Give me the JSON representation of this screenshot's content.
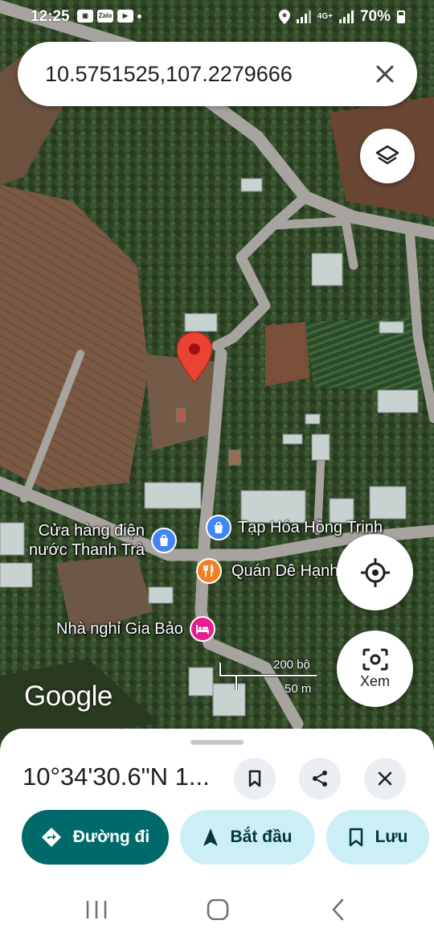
{
  "status_bar": {
    "time": "12:25",
    "battery": "70%",
    "network": "4G+",
    "app_icons": [
      "gallery-icon",
      "zalo-icon",
      "youtube-icon"
    ],
    "zalo_text": "Zalo"
  },
  "search": {
    "query": "10.5751525,107.2279666"
  },
  "map": {
    "pois": [
      {
        "name": "Cửa hàng điện\nnước Thanh Trà",
        "type": "shop",
        "icon": "shopping-bag-icon",
        "color": "#4285f4"
      },
      {
        "name": "Tạp Hóa Hồng Trinh",
        "type": "shop",
        "icon": "shopping-bag-icon",
        "color": "#4285f4"
      },
      {
        "name": "Quán Dê Hạnh",
        "type": "restaurant",
        "icon": "fork-knife-icon",
        "color": "#f07f26"
      },
      {
        "name": "Nhà nghỉ Gia Bảo",
        "type": "lodging",
        "icon": "bed-icon",
        "color": "#e91e8c"
      }
    ],
    "pin_color": "#ea4335",
    "scale": {
      "imperial": "200 bộ",
      "metric": "50 m"
    },
    "logo": "Google",
    "lens_label": "Xem"
  },
  "sheet": {
    "title": "10°34'30.6\"N 1...",
    "actions": {
      "directions": "Đường đi",
      "start": "Bắt đầu",
      "save": "Lưu"
    },
    "colors": {
      "primary": "#006a6a",
      "tonal": "#cbeff5"
    }
  }
}
